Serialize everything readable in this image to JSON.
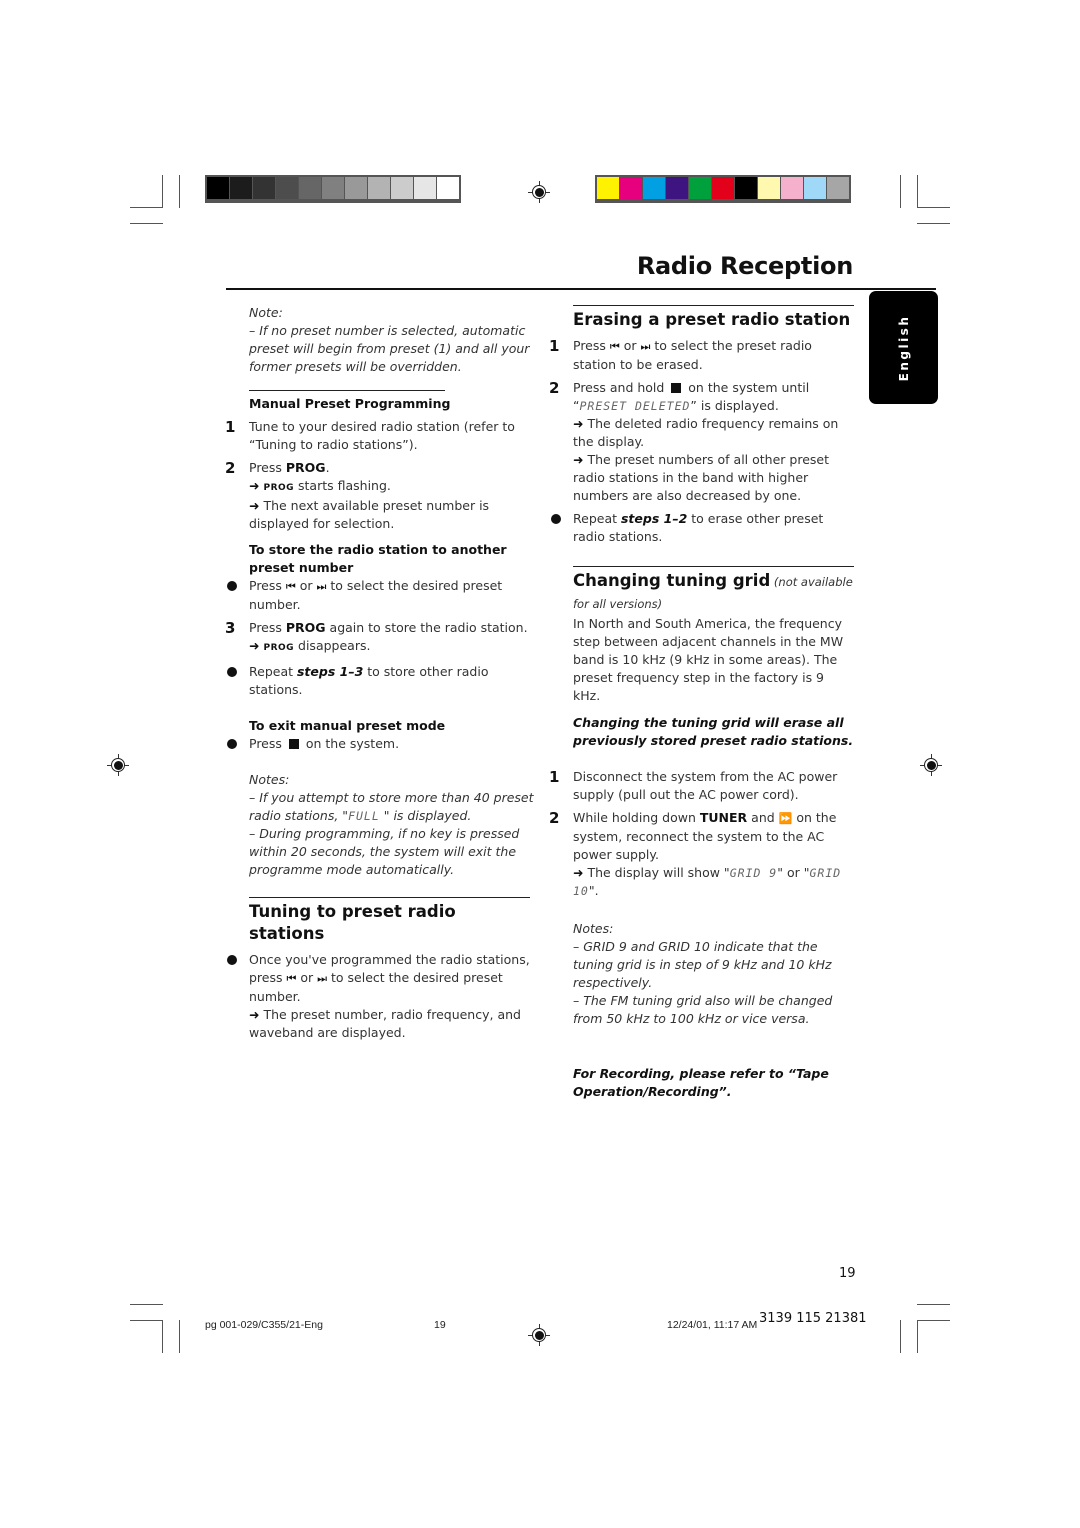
{
  "page": {
    "title": "Radio Reception",
    "language_tab": "English",
    "page_number": "19"
  },
  "print_marks": {
    "grayscale_swatches": [
      "#000000",
      "#1c1c1c",
      "#333333",
      "#4d4d4d",
      "#666666",
      "#808080",
      "#999999",
      "#b3b3b3",
      "#cccccc",
      "#e6e6e6",
      "#ffffff"
    ],
    "color_swatches": [
      "#fff200",
      "#e6007e",
      "#00a0e3",
      "#3d1480",
      "#00a03c",
      "#e2001a",
      "#000000",
      "#fff9b0",
      "#f5b1cc",
      "#a0d8f7",
      "#a6a6a6"
    ]
  },
  "left_column": {
    "note_label": "Note:",
    "note_text": "–  If no preset number is selected, automatic preset will begin from preset (1) and all your former presets will be overridden.",
    "manual_heading": "Manual Preset Programming",
    "step1_num": "1",
    "step1_text": "Tune to your desired radio station (refer to “Tuning to radio stations”).",
    "step2_num": "2",
    "step2_pre": "Press ",
    "step2_bold": "PROG",
    "step2_post": ".",
    "step2_arrow1_key": "PROG",
    "step2_arrow1_text": " starts flashing.",
    "step2_arrow2_text": " The next available preset number is displayed for selection.",
    "store_heading": "To store the radio station to another preset number",
    "store_bullet_pre": "Press ",
    "store_bullet_or": " or ",
    "store_bullet_post": " to select the desired preset number.",
    "step3_num": "3",
    "step3_pre": "Press ",
    "step3_bold": "PROG",
    "step3_post": " again to store the radio station.",
    "step3_arrow_key": "PROG",
    "step3_arrow_text": " disappears.",
    "repeat_pre": "Repeat ",
    "repeat_bold": "steps 1–3",
    "repeat_post": " to store other radio stations.",
    "exit_heading": "To exit manual preset mode",
    "exit_pre": "Press ",
    "exit_post": " on the system.",
    "notes_label": "Notes:",
    "notes1_pre": "–  If you attempt to store more than 40 preset radio stations, \"",
    "notes1_lcd": "FULL",
    "notes1_post": " \" is displayed.",
    "notes2": "–  During programming, if no key is pressed within 20 seconds, the system will exit the programme mode automatically.",
    "tuning_heading": "Tuning to preset radio stations",
    "tuning_bullet_pre": "Once you've programmed the radio stations, press ",
    "tuning_bullet_or": " or ",
    "tuning_bullet_post": " to select the desired preset number.",
    "tuning_arrow_text": " The preset number, radio frequency, and waveband are displayed."
  },
  "right_column": {
    "erase_heading": "Erasing a preset radio station",
    "e1_num": "1",
    "e1_pre": "Press ",
    "e1_or": " or ",
    "e1_post": " to select the preset radio station to be erased.",
    "e2_num": "2",
    "e2_pre": "Press and hold ",
    "e2_post": " on the system until",
    "e2_lcd_open": "“",
    "e2_lcd": "PRESET DELETED",
    "e2_lcd_close": "” is displayed.",
    "e2_arrow1": " The deleted radio frequency remains on the display.",
    "e2_arrow2": " The preset numbers of all other preset radio stations in the band with higher numbers are also decreased by one.",
    "erase_repeat_pre": "Repeat ",
    "erase_repeat_bold": "steps 1–2",
    "erase_repeat_post": " to erase other preset radio stations.",
    "grid_heading": "Changing tuning grid",
    "grid_heading_note": " (not available for all versions)",
    "grid_intro": "In North and South America, the frequency step between adjacent channels in the MW band is 10 kHz (9 kHz in some areas).  The preset frequency step in the factory is 9 kHz.",
    "grid_warning": "Changing the tuning grid will erase all previously stored preset radio stations.",
    "g1_num": "1",
    "g1_text": "Disconnect the system from the AC power supply (pull out the AC power cord).",
    "g2_num": "2",
    "g2_pre": "While holding down ",
    "g2_bold": "TUNER",
    "g2_mid": " and ",
    "g2_post": " on the system, reconnect the system to the AC power supply.",
    "g2_arrow_pre": " The display will show \"",
    "g2_lcd1": "GRID 9",
    "g2_arrow_mid": "\" or \"",
    "g2_lcd2": "GRID 10",
    "g2_arrow_post": "\".",
    "grid_notes_label": "Notes:",
    "grid_note1": "–  GRID 9 and GRID 10 indicate that the tuning grid is in step of 9 kHz and 10 kHz respectively.",
    "grid_note2": "–  The FM tuning grid also will be changed from 50 kHz to 100 kHz or vice versa.",
    "recording_ref": "For Recording, please refer to “Tape Operation/Recording”."
  },
  "icons": {
    "prev": "⏮",
    "next": "⏭",
    "ffwd": "⏩",
    "arrow": "➜"
  },
  "footer": {
    "file": "pg 001-029/C355/21-Eng",
    "sheet": "19",
    "timestamp": "12/24/01, 11:17 AM",
    "code": "3139 115 21381"
  }
}
